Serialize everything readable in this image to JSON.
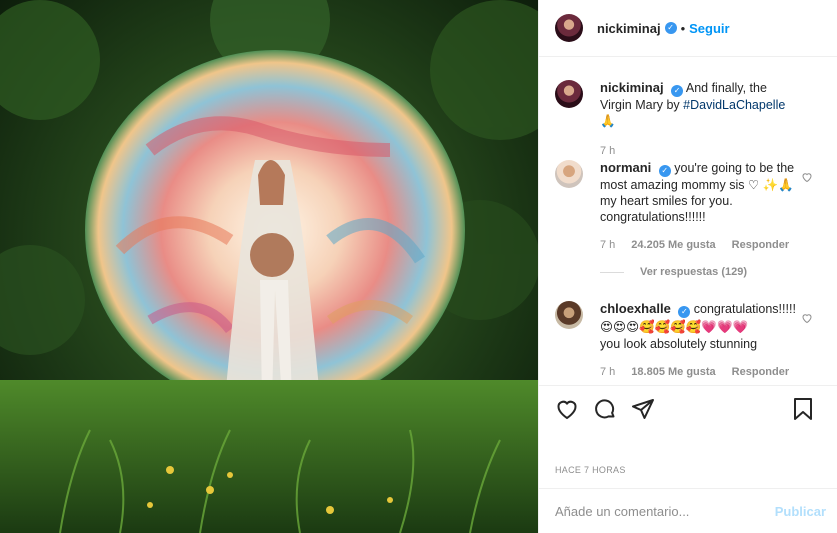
{
  "post": {
    "image_alt": "post-photo"
  },
  "header": {
    "username": "nickiminaj",
    "separator": "•",
    "follow_label": "Seguir"
  },
  "caption": {
    "username": "nickiminaj",
    "text_before_link": "And finally, the Virgin Mary by ",
    "hashtag": "#DavidLaChapelle",
    "emoji": "🙏",
    "time": "7 h"
  },
  "comments": [
    {
      "username": "normani",
      "text": "you're going to be the most amazing mommy sis ♡ ✨🙏 my heart smiles for you. congratulations!!!!!!",
      "time": "7 h",
      "likes": "24.205 Me gusta",
      "reply_label": "Responder"
    },
    {
      "username": "chloexhalle",
      "text_start": "congratulations!!!!!",
      "text_end": "you look absolutely stunning",
      "emojis": [
        "😍",
        "😍",
        "😍",
        "🥰",
        "🥰",
        "🥰",
        "🥰",
        "💗",
        "💗",
        "💗"
      ],
      "time": "7 h",
      "likes": "18.805 Me gusta",
      "reply_label": "Responder"
    }
  ],
  "view_replies": "Ver respuestas (129)",
  "timestamp": "HACE 7 HORAS",
  "add_comment": {
    "placeholder": "Añade un comentario...",
    "publish_label": "Publicar"
  },
  "colors": {
    "accent": "#0095f6",
    "verified": "#3897f0",
    "publish_disabled": "#b2dffc"
  }
}
